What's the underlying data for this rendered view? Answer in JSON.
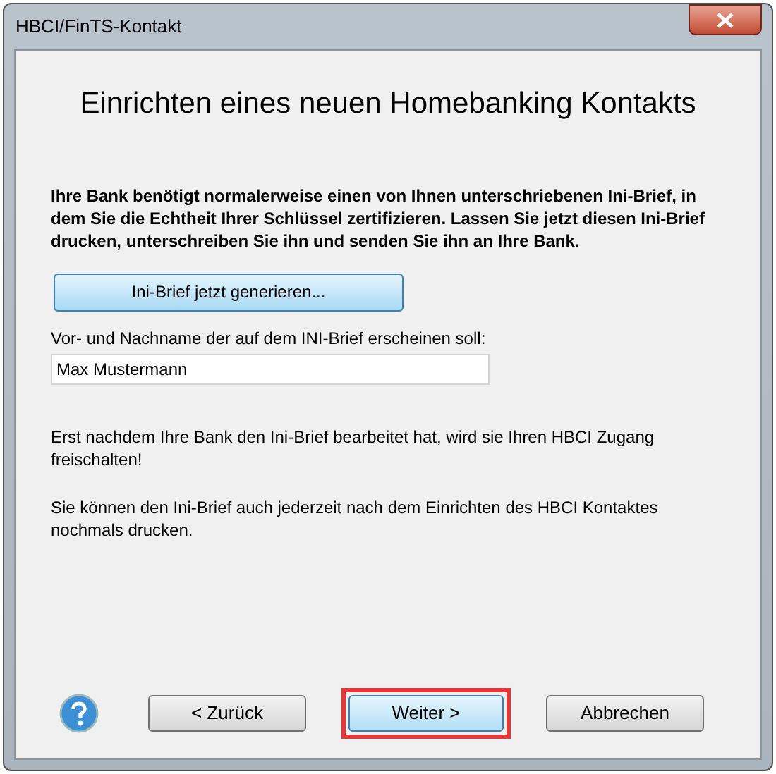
{
  "window": {
    "title": "HBCI/FinTS-Kontakt"
  },
  "heading": "Einrichten eines neuen Homebanking Kontakts",
  "intro": "Ihre Bank benötigt normalerweise einen von Ihnen unterschriebenen Ini-Brief, in dem Sie die Echtheit Ihrer Schlüssel zertifizieren. Lassen Sie jetzt diesen Ini-Brief drucken, unterschreiben Sie ihn und senden Sie ihn an Ihre Bank.",
  "generate_button": {
    "label": "Ini-Brief jetzt generieren...",
    "focused": true
  },
  "name_field": {
    "label": "Vor- und Nachname der auf dem INI-Brief erscheinen soll:",
    "value": "Max Mustermann"
  },
  "notes": [
    "Erst nachdem Ihre Bank den Ini-Brief bearbeitet hat, wird sie Ihren HBCI Zugang freischalten!",
    "Sie können den Ini-Brief auch jederzeit nach dem Einrichten des HBCI Kontaktes nochmals drucken."
  ],
  "buttons": [
    {
      "label": "< Zurück",
      "focused": false,
      "highlighted": false
    },
    {
      "label": "Weiter >",
      "focused": true,
      "highlighted": true
    },
    {
      "label": "Abbrechen",
      "focused": false,
      "highlighted": false
    }
  ]
}
